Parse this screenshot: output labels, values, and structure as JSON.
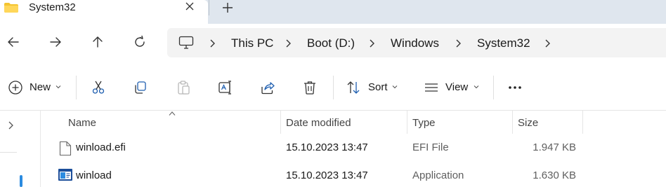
{
  "tab": {
    "title": "System32",
    "close_icon": "close-icon",
    "new_tab_icon": "plus-icon"
  },
  "nav": {
    "back_icon": "arrow-left-icon",
    "forward_icon": "arrow-right-icon",
    "up_icon": "arrow-up-icon",
    "refresh_icon": "refresh-icon"
  },
  "breadcrumb": {
    "root_icon": "monitor-icon",
    "items": [
      "This PC",
      "Boot (D:)",
      "Windows",
      "System32"
    ]
  },
  "toolbar": {
    "new_label": "New",
    "sort_label": "Sort",
    "view_label": "View",
    "icons": [
      "cut-icon",
      "copy-icon",
      "paste-icon",
      "rename-icon",
      "share-icon",
      "delete-icon"
    ],
    "more_icon": "more-icon"
  },
  "columns": {
    "name": "Name",
    "date": "Date modified",
    "type": "Type",
    "size": "Size"
  },
  "files": [
    {
      "name": "winload.efi",
      "date": "15.10.2023 13:47",
      "type": "EFI File",
      "size": "1.947 KB",
      "icon": "file-icon"
    },
    {
      "name": "winload",
      "date": "15.10.2023 13:47",
      "type": "Application",
      "size": "1.630 KB",
      "icon": "application-icon"
    }
  ],
  "colors": {
    "tabbar_bg": "#dfe6ee",
    "folder": "#f4c430",
    "accent": "#2b8be0"
  }
}
